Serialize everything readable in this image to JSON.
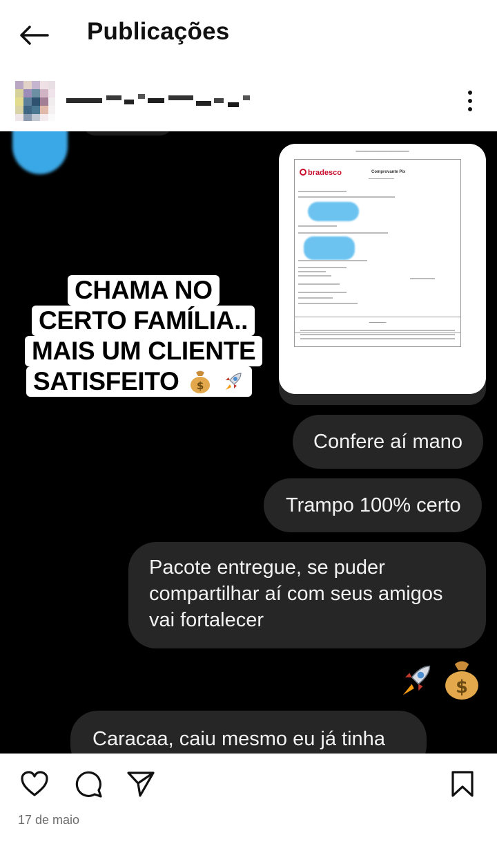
{
  "header": {
    "title": "Publicações",
    "back_icon": "arrow-left-icon"
  },
  "post": {
    "username": "",
    "more_icon": "more-vertical-icon",
    "receipt": {
      "bank_name": "bradesco",
      "doc_title": "Comprovante Pix"
    },
    "caption_lines": [
      "CHAMA NO",
      "CERTO FAMÍLIA..",
      "MAIS UM CLIENTE",
      "SATISFEITO"
    ],
    "messages": [
      {
        "text": "Confere aí mano"
      },
      {
        "text": "Trampo 100% certo"
      },
      {
        "lines": [
          "Pacote entregue, se puder",
          "compartilhar aí com seus amigos",
          "vai fortalecer"
        ]
      },
      {
        "text": "Caracaa, caiu mesmo eu já tinha"
      }
    ],
    "emoji_icons": [
      "rocket-icon",
      "money-bag-icon"
    ]
  },
  "footer": {
    "icons": [
      "heart-icon",
      "comment-icon",
      "share-icon",
      "bookmark-icon"
    ],
    "date": "17 de maio"
  },
  "colors": {
    "bubble_bg": "#262626",
    "bubble_text": "#f2f2f2",
    "receipt_blur": "#6cc3f0",
    "bank_red": "#c8102e"
  }
}
